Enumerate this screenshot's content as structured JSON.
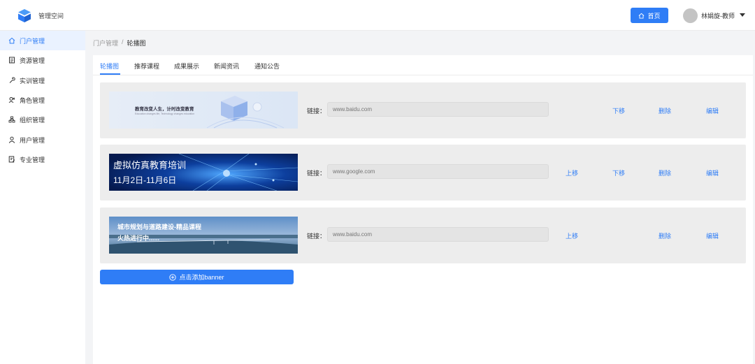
{
  "app": {
    "title": "管理空间"
  },
  "header": {
    "home_label": "首页",
    "user_name": "林娟旋-教师"
  },
  "sidebar": {
    "items": [
      {
        "label": "门户管理",
        "icon": "home-icon",
        "active": true
      },
      {
        "label": "资源管理",
        "icon": "document-icon",
        "active": false
      },
      {
        "label": "实训管理",
        "icon": "wrench-icon",
        "active": false
      },
      {
        "label": "角色管理",
        "icon": "roles-icon",
        "active": false
      },
      {
        "label": "组织管理",
        "icon": "org-chart-icon",
        "active": false
      },
      {
        "label": "用户管理",
        "icon": "user-icon",
        "active": false
      },
      {
        "label": "专业管理",
        "icon": "edit-doc-icon",
        "active": false
      }
    ]
  },
  "breadcrumb": {
    "parent": "门户管理",
    "separator": "/",
    "current": "轮播图"
  },
  "tabs": [
    "轮播图",
    "推荐课程",
    "成果展示",
    "新闻资讯",
    "通知公告"
  ],
  "banners": [
    {
      "image_text_1": "教育改变人生，计时改变教育",
      "image_text_2": "Education changes life, Technology changes education",
      "link_label": "链接：",
      "link_value": "www.baidu.com",
      "actions": {
        "down": "下移",
        "delete": "删除",
        "edit": "编辑"
      }
    },
    {
      "image_text_1": "虚拟仿真教育培训",
      "image_text_2": "11月2日-11月6日",
      "link_label": "链接：",
      "link_value": "www.google.com",
      "actions": {
        "up": "上移",
        "down": "下移",
        "delete": "删除",
        "edit": "编辑"
      }
    },
    {
      "image_text_1": "城市规划与道路建设-精品课程",
      "image_text_2": "火热进行中......",
      "link_label": "链接：",
      "link_value": "www.baidu.com",
      "actions": {
        "up": "上移",
        "delete": "删除",
        "edit": "编辑"
      }
    }
  ],
  "add_button": {
    "label": "点击添加banner"
  },
  "colors": {
    "accent": "#2f7df6",
    "sidebar_active_bg": "#eaf2ff"
  }
}
